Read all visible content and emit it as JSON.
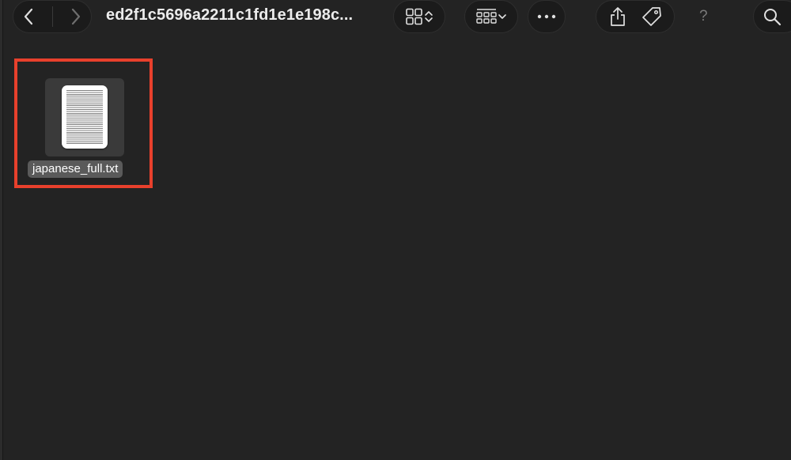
{
  "toolbar": {
    "title": "ed2f1c5696a2211c1fd1e1e198c...",
    "help_label": "?",
    "icons": {
      "back": "chevron-left-icon",
      "forward": "chevron-right-icon",
      "view": "grid-view-icon",
      "group": "group-by-icon",
      "more": "ellipsis-icon",
      "share": "share-icon",
      "tag": "tag-icon",
      "search": "search-icon"
    }
  },
  "files": [
    {
      "name": "japanese_full.txt",
      "icon": "text-document-icon",
      "selected": true
    }
  ],
  "colors": {
    "background": "#232323",
    "toolbar_pill": "#1b1b1b",
    "selection_label": "#5a5a5a",
    "highlight_box": "#e8402c"
  }
}
